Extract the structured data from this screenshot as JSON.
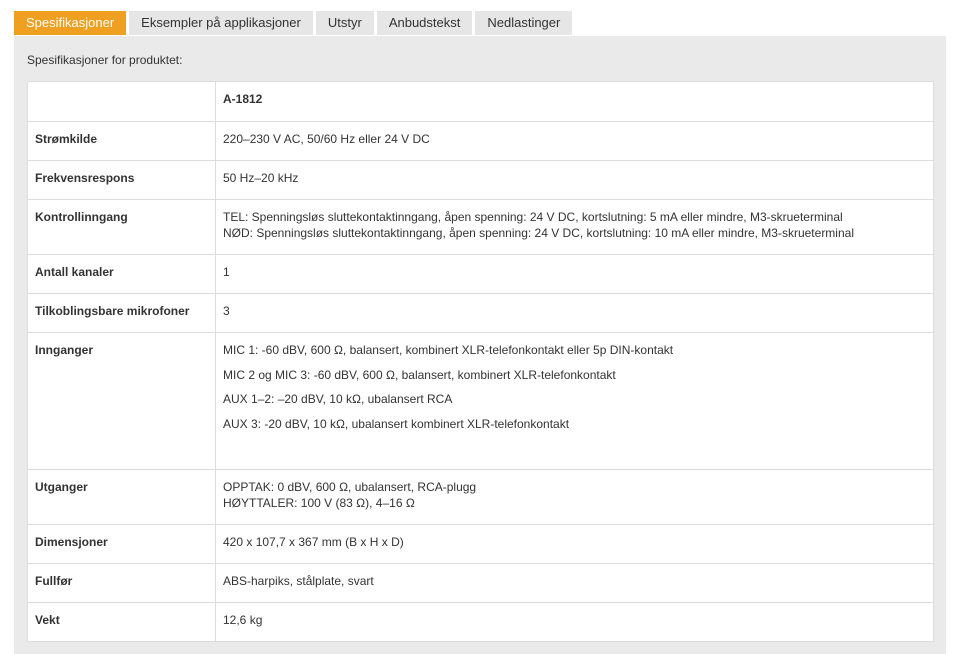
{
  "tabs": [
    {
      "label": "Spesifikasjoner",
      "active": true
    },
    {
      "label": "Eksempler på applikasjoner",
      "active": false
    },
    {
      "label": "Utstyr",
      "active": false
    },
    {
      "label": "Anbudstekst",
      "active": false
    },
    {
      "label": "Nedlastinger",
      "active": false
    }
  ],
  "intro": "Spesifikasjoner for produktet:",
  "model": "A-1812",
  "rows": [
    {
      "key": "Strømkilde",
      "lines": [
        "220–230 V AC, 50/60 Hz eller 24 V DC"
      ]
    },
    {
      "key": "Frekvensrespons",
      "lines": [
        "50 Hz–20 kHz"
      ]
    },
    {
      "key": "Kontrollinngang",
      "lines": [
        "TEL: Spenningsløs sluttekontaktinngang, åpen spenning: 24 V DC, kortslutning: 5 mA eller mindre, M3-skrueterminal",
        "NØD: Spenningsløs sluttekontaktinngang, åpen spenning: 24 V DC, kortslutning: 10 mA eller mindre, M3-skrueterminal"
      ]
    },
    {
      "key": "Antall kanaler",
      "lines": [
        "1"
      ]
    },
    {
      "key": "Tilkoblingsbare mikrofoner",
      "lines": [
        "3"
      ]
    },
    {
      "key": "Innganger",
      "lines": [
        "MIC 1: -60 dBV, 600 Ω, balansert, kombinert XLR-telefonkontakt eller 5p DIN-kontakt",
        "MIC 2 og MIC 3: -60 dBV, 600 Ω, balansert, kombinert XLR-telefonkontakt",
        "AUX 1–2: –20 dBV, 10 kΩ, ubalansert RCA",
        "AUX 3: -20 dBV, 10 kΩ, ubalansert kombinert XLR-telefonkontakt"
      ]
    },
    {
      "key": "Utganger",
      "lines": [
        "OPPTAK: 0 dBV, 600 Ω, ubalansert, RCA-plugg",
        "HØYTTALER:  100 V (83 Ω), 4–16 Ω"
      ]
    },
    {
      "key": "Dimensjoner",
      "lines": [
        "420 x 107,7 x 367 mm (B x H x D)"
      ]
    },
    {
      "key": "Fullfør",
      "lines": [
        "ABS-harpiks, stålplate, svart"
      ]
    },
    {
      "key": "Vekt",
      "lines": [
        "12,6 kg"
      ]
    }
  ],
  "colors": {
    "active_tab": "#f0a020",
    "tab": "#e6e6e6",
    "panel": "#eaeaea"
  }
}
